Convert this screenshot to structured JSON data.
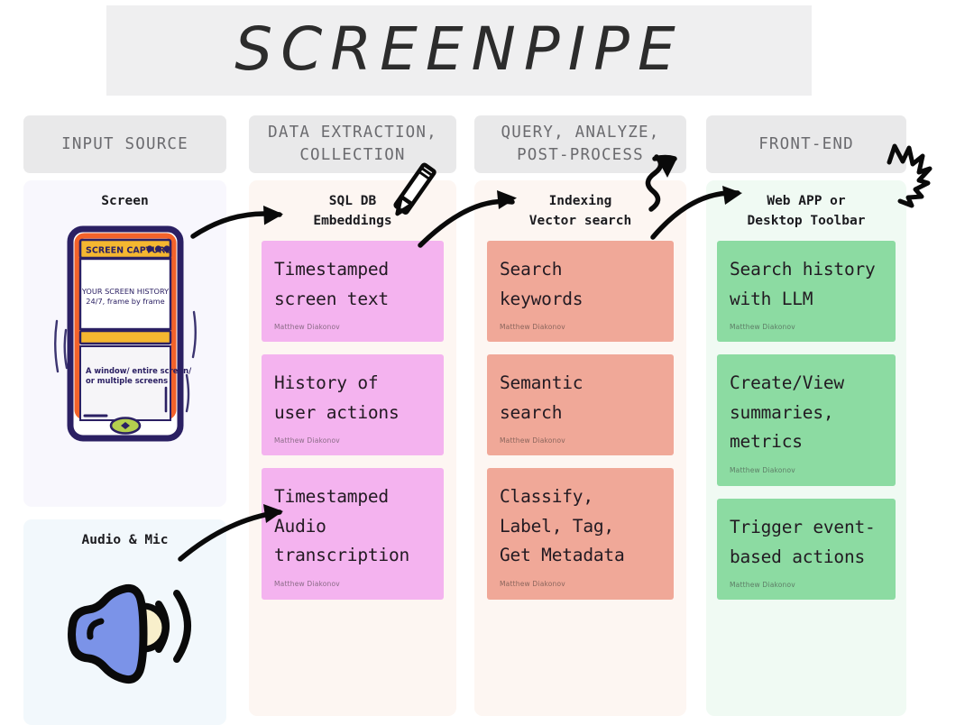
{
  "title": "SCREENPIPE",
  "columns": [
    {
      "id": "input-source",
      "header": "INPUT SOURCE",
      "panels": [
        {
          "id": "screen",
          "subtitle": "Screen",
          "illustration": "screen-capture-window-icon",
          "window_title": "SCREEN CAPTURE",
          "screen_line1": "YOUR SCREEN HISTORY",
          "screen_line2": "24/7, frame by frame",
          "caption_line1": "A window/ entire screen/",
          "caption_line2": "or multiple screens"
        },
        {
          "id": "audio",
          "subtitle": "Audio & Mic",
          "illustration": "speaker-sound-icon"
        }
      ]
    },
    {
      "id": "data-extraction",
      "header_line1": "DATA EXTRACTION,",
      "header_line2": "COLLECTION",
      "subtitle_line1": "SQL DB",
      "subtitle_line2": "Embeddings",
      "cards": [
        {
          "line1": "Timestamped",
          "line2": "screen text",
          "author": "Matthew Diakonov"
        },
        {
          "line1": "History of",
          "line2": "user actions",
          "author": "Matthew Diakonov"
        },
        {
          "line1": "Timestamped",
          "line2": "Audio",
          "line3": "transcription",
          "author": "Matthew Diakonov"
        }
      ]
    },
    {
      "id": "query-analyze",
      "header_line1": "QUERY, ANALYZE,",
      "header_line2": "POST-PROCESS",
      "subtitle_line1": "Indexing",
      "subtitle_line2": "Vector search",
      "cards": [
        {
          "line1": "Search",
          "line2": "keywords",
          "author": "Matthew Diakonov"
        },
        {
          "line1": "Semantic",
          "line2": "search",
          "author": "Matthew Diakonov"
        },
        {
          "line1": "Classify,",
          "line2": "Label, Tag,",
          "line3": "Get Metadata",
          "author": "Matthew Diakonov"
        }
      ]
    },
    {
      "id": "front-end",
      "header": "FRONT-END",
      "subtitle_line1": "Web APP or",
      "subtitle_line2": "Desktop Toolbar",
      "cards": [
        {
          "line1": "Search history",
          "line2": "with LLM",
          "author": "Matthew Diakonov"
        },
        {
          "line1": "Create/View",
          "line2": "summaries,",
          "line3": "metrics",
          "author": "Matthew Diakonov"
        },
        {
          "line1": "Trigger event-",
          "line2": "based actions",
          "author": "Matthew Diakonov"
        }
      ]
    }
  ],
  "decorations": {
    "pencil": "pencil-icon",
    "squiggle_arrow": "squiggle-arrow-icon",
    "zigzag": "zigzag-spark-icon",
    "arrow1": "arrow-right-icon",
    "arrow2": "arrow-right-icon",
    "arrow3": "arrow-right-icon",
    "arrow4": "arrow-right-icon"
  },
  "colors": {
    "banner_bg": "#efeff0",
    "header_bg": "#e9e9ea",
    "pink": "#f4b3ef",
    "salmon": "#f0a898",
    "green": "#8cdba2",
    "panel_warm": "#fdf6f2",
    "panel_green": "#f0faf3",
    "panel_blue": "#f2f8fc",
    "panel_lilac": "#f8f7fd",
    "screen_navy": "#2b2063",
    "screen_orange": "#f2622a",
    "screen_yellow": "#f5b730",
    "speaker_blue": "#7b93e8",
    "speaker_cream": "#f8efcb"
  }
}
